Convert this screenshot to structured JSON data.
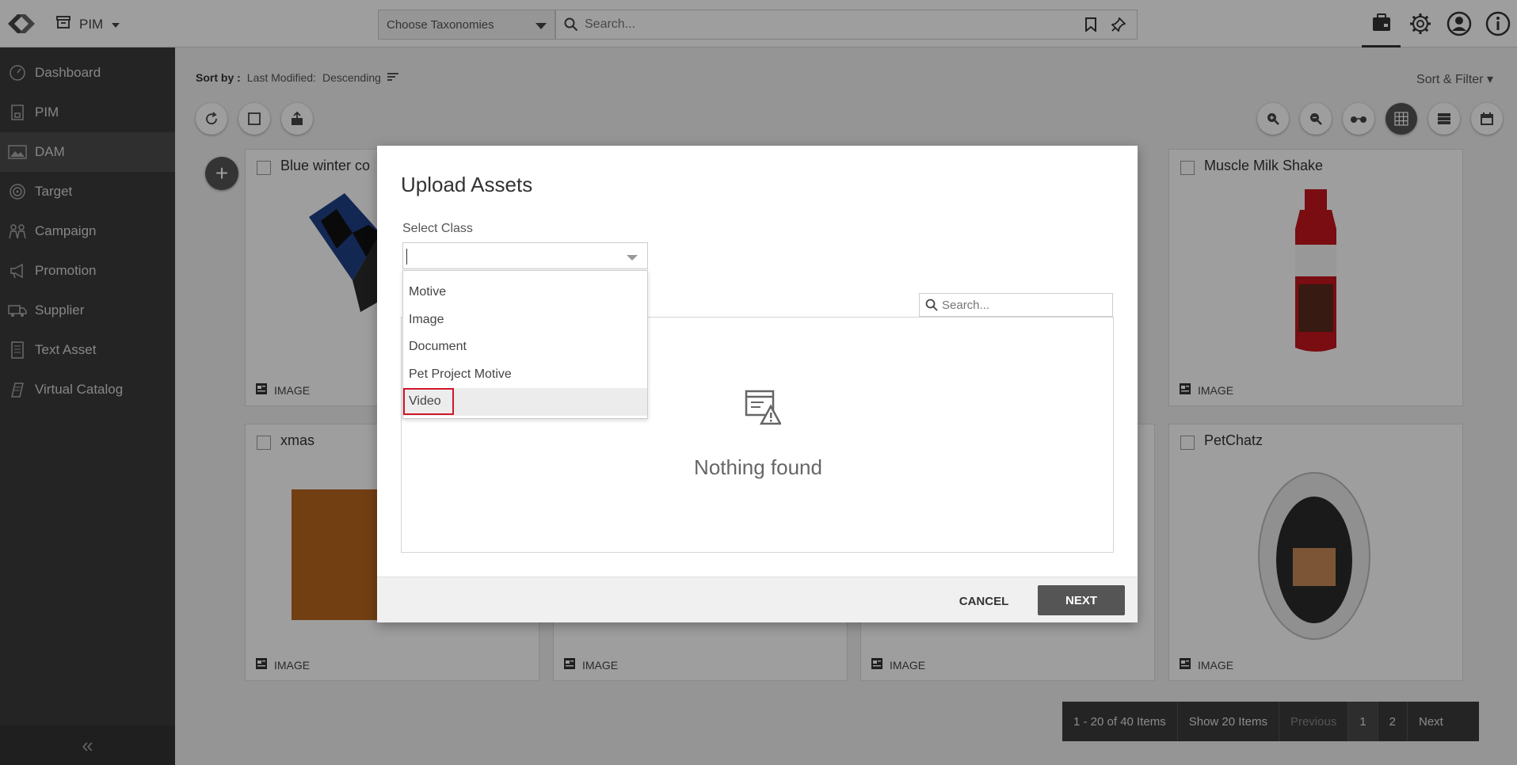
{
  "topbar": {
    "app_name": "PIM",
    "taxonomy_placeholder": "Choose Taxonomies",
    "search_placeholder": "Search..."
  },
  "sidebar": {
    "items": [
      {
        "label": "Dashboard",
        "icon": "dashboard-icon"
      },
      {
        "label": "PIM",
        "icon": "pim-icon"
      },
      {
        "label": "DAM",
        "icon": "image-icon",
        "active": true
      },
      {
        "label": "Target",
        "icon": "target-icon"
      },
      {
        "label": "Campaign",
        "icon": "campaign-icon"
      },
      {
        "label": "Promotion",
        "icon": "megaphone-icon"
      },
      {
        "label": "Supplier",
        "icon": "truck-icon"
      },
      {
        "label": "Text Asset",
        "icon": "text-document-icon"
      },
      {
        "label": "Virtual Catalog",
        "icon": "catalog-icon"
      }
    ],
    "collapse_glyph": "«"
  },
  "sort": {
    "label": "Sort by :",
    "field": "Last Modified:",
    "direction": "Descending",
    "filter_label": "Sort & Filter"
  },
  "cards": [
    {
      "title": "Blue winter co",
      "type": "IMAGE"
    },
    {
      "title": "Muscle Milk Shake",
      "type": "IMAGE"
    },
    {
      "title": "xmas",
      "type": "IMAGE"
    },
    {
      "title": "",
      "type": "IMAGE"
    },
    {
      "title": "",
      "type": "IMAGE"
    },
    {
      "title": "PetChatz",
      "type": "IMAGE"
    }
  ],
  "pagination": {
    "summary": "1 - 20 of 40 Items",
    "page_size": "Show 20 Items",
    "previous": "Previous",
    "pages": [
      "1",
      "2"
    ],
    "next": "Next"
  },
  "modal": {
    "title": "Upload Assets",
    "select_class_label": "Select Class",
    "options": [
      "Motive",
      "Image",
      "Document",
      "Pet Project Motive",
      "Video"
    ],
    "highlighted_option": "Video",
    "search_placeholder": "Search...",
    "empty_text": "Nothing found",
    "cancel_label": "CANCEL",
    "next_label": "NEXT"
  },
  "colors": {
    "sidebar_bg": "#3a3a3a",
    "highlight_border": "#d0172a",
    "primary_button": "#555555"
  }
}
